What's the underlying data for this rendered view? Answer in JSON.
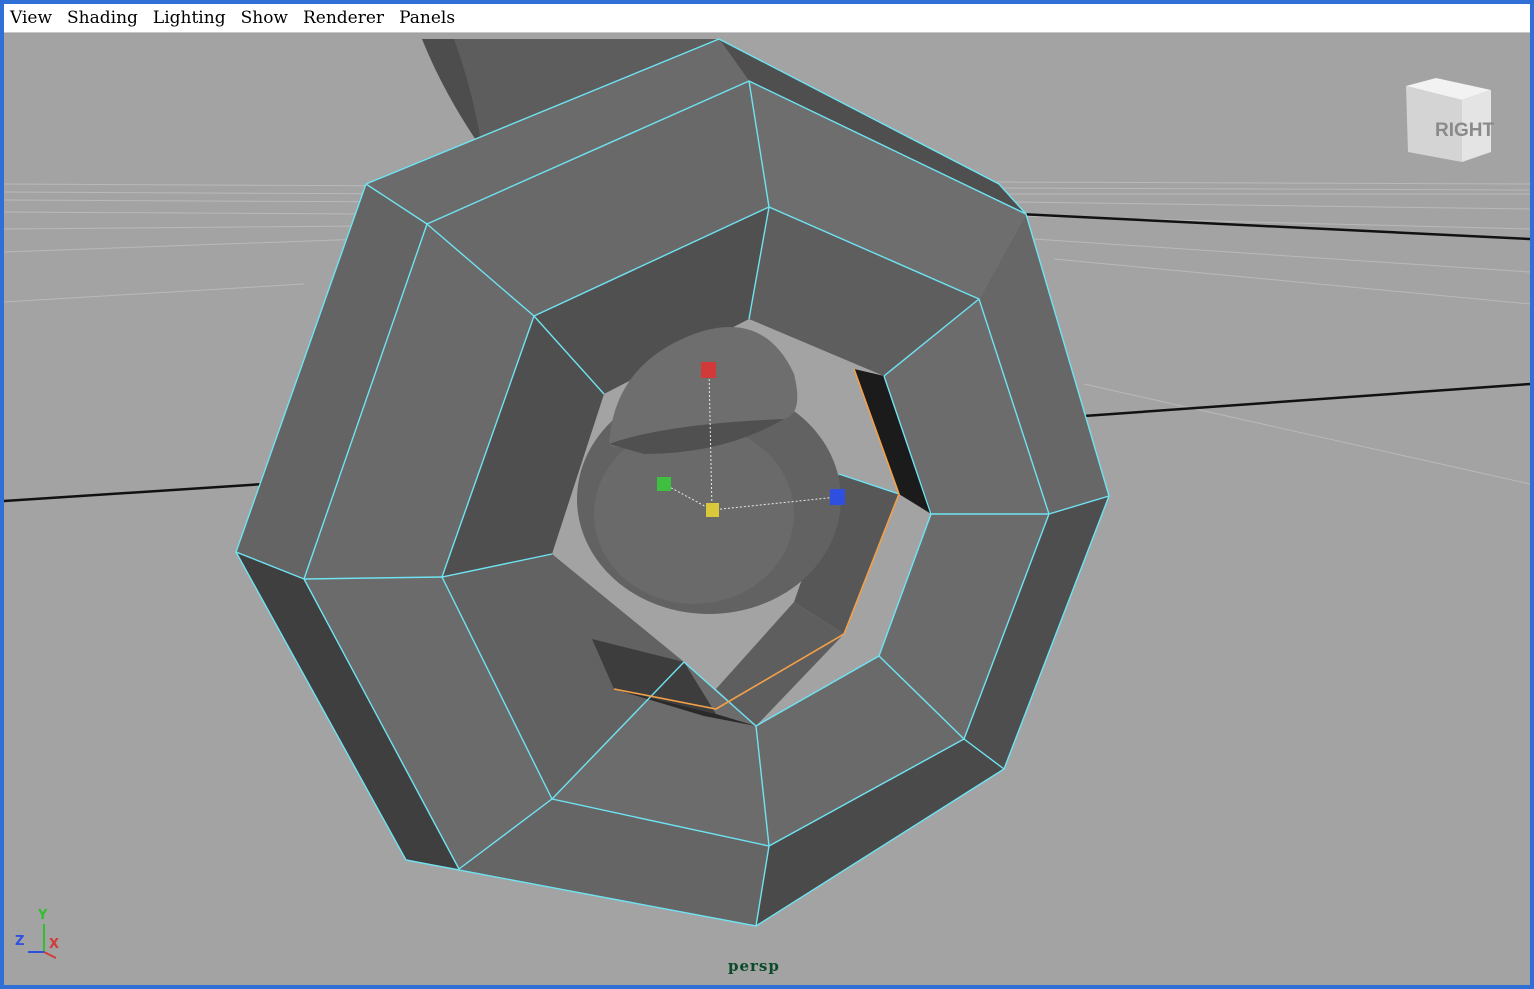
{
  "menubar": {
    "items": [
      "View",
      "Shading",
      "Lighting",
      "Show",
      "Renderer",
      "Panels"
    ]
  },
  "viewport": {
    "camera_label": "persp",
    "view_cube_label": "RIGHT",
    "axis_labels": {
      "y": "Y",
      "z": "Z",
      "x": "X"
    }
  },
  "colors": {
    "wire": "#6fe3f2",
    "selected_edge": "#f2a04a",
    "mesh_face": "#6a6a6a",
    "background": "#a3a3a3",
    "manip_x": "#d23a3a",
    "manip_y": "#3fbf3f",
    "manip_z": "#2f4fe0",
    "manip_center": "#d8c83a"
  }
}
